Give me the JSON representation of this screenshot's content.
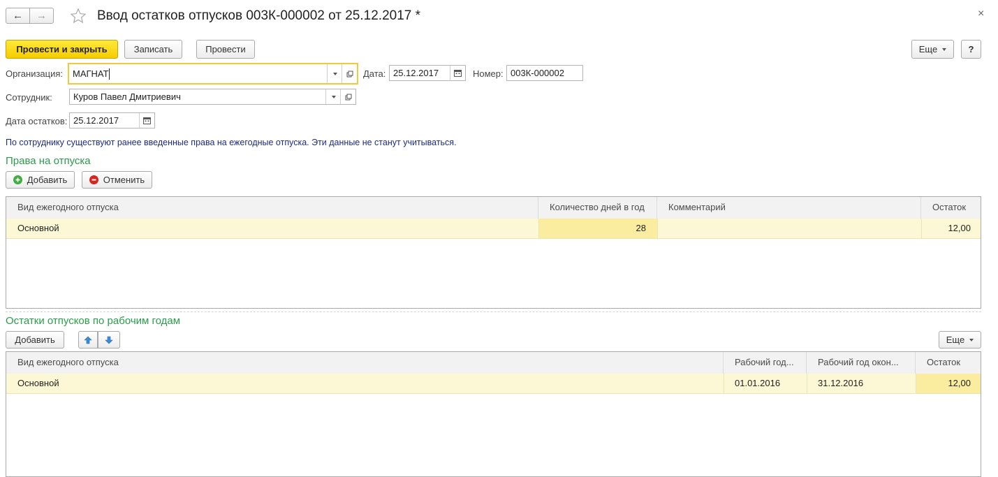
{
  "window": {
    "title": "Ввод остатков отпусков 003К-000002 от 25.12.2017 *"
  },
  "toolbar": {
    "post_close": "Провести и закрыть",
    "save": "Записать",
    "post": "Провести",
    "more": "Еще",
    "help": "?"
  },
  "form": {
    "org_label": "Организация:",
    "org_value": "МАГНАТ",
    "date_label": "Дата:",
    "date_value": "25.12.2017",
    "number_label": "Номер:",
    "number_value": "003К-000002",
    "employee_label": "Сотрудник:",
    "employee_value": "Куров Павел Дмитриевич",
    "balance_date_label": "Дата остатков:",
    "balance_date_value": "25.12.2017"
  },
  "notice": "По сотруднику существуют ранее введенные права на ежегодные отпуска. Эти данные не станут учитываться.",
  "rights": {
    "title": "Права на отпуска",
    "add": "Добавить",
    "cancel": "Отменить",
    "columns": [
      "Вид ежегодного отпуска",
      "Количество дней в год",
      "Комментарий",
      "Остаток"
    ],
    "rows": [
      {
        "type": "Основной",
        "days": "28",
        "comment": "",
        "balance": "12,00"
      }
    ]
  },
  "balances": {
    "title": "Остатки отпусков по рабочим годам",
    "add": "Добавить",
    "more": "Еще",
    "columns": [
      "Вид ежегодного отпуска",
      "Рабочий год...",
      "Рабочий год окон...",
      "Остаток"
    ],
    "rows": [
      {
        "type": "Основной",
        "start": "01.01.2016",
        "end": "31.12.2016",
        "balance": "12,00"
      }
    ]
  },
  "colors": {
    "accent_yellow": "#f6cc00",
    "section_green": "#2a9d4a",
    "notice_blue": "#1a2a8c",
    "row_highlight": "#fcf7d4"
  }
}
